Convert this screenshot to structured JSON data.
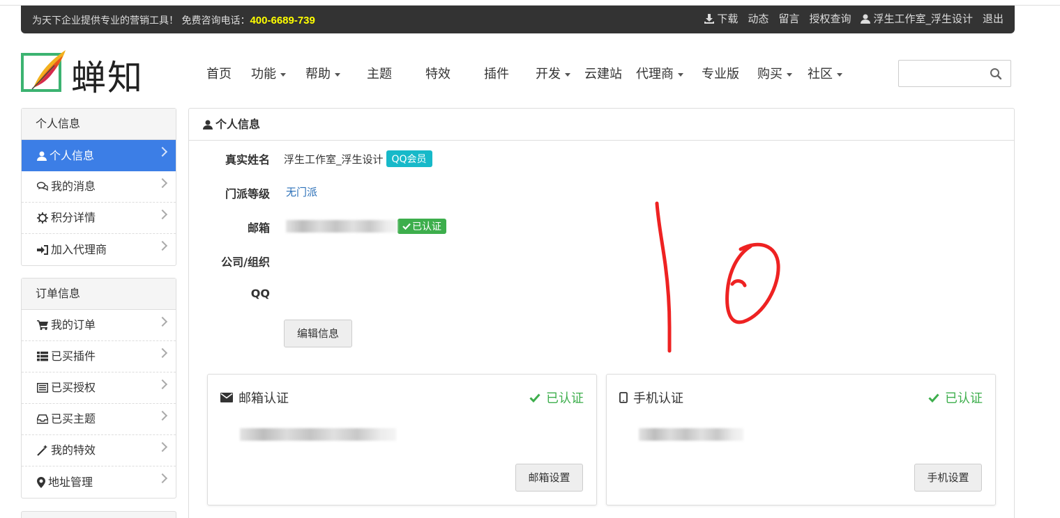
{
  "topbar": {
    "slogan": "为天下企业提供专业的营销工具！ 免费咨询电话：",
    "phone": "400-6689-739",
    "download": "下载",
    "news": "动态",
    "message": "留言",
    "license_query": "授权查询",
    "username": "浮生工作室_浮生设计",
    "logout": "退出"
  },
  "logo": {
    "text": "蝉知"
  },
  "nav": {
    "home": "首页",
    "features": "功能",
    "help": "帮助",
    "themes": "主题",
    "effects": "特效",
    "plugins": "插件",
    "develop": "开发",
    "cloud": "云建站",
    "agent": "代理商",
    "pro": "专业版",
    "buy": "购买",
    "community": "社区"
  },
  "search": {
    "placeholder": ""
  },
  "sidebar": {
    "personal_header": "个人信息",
    "personal_items": [
      "个人信息",
      "我的消息",
      "积分详情",
      "加入代理商"
    ],
    "order_header": "订单信息",
    "order_items": [
      "我的订单",
      "已买插件",
      "已买授权",
      "已买主题",
      "我的特效",
      "地址管理"
    ]
  },
  "main": {
    "title": "个人信息",
    "real_name_label": "真实姓名",
    "real_name_value": "浮生工作室_浮生设计",
    "qq_member_badge": "QQ会员",
    "sect_label": "门派等级",
    "sect_value": "无门派",
    "email_label": "邮箱",
    "verified_badge": "已认证",
    "company_label": "公司/组织",
    "qq_label": "QQ",
    "edit_button": "编辑信息"
  },
  "email_card": {
    "title": "邮箱认证",
    "status": "已认证",
    "button": "邮箱设置"
  },
  "phone_card": {
    "title": "手机认证",
    "status": "已认证",
    "button": "手机设置"
  },
  "colors": {
    "topbar_bg": "#333333",
    "phone_yellow": "#ffff00",
    "active_blue": "#3c7ee6",
    "verified_green": "#3dae4c",
    "qq_badge": "#17b9c9",
    "annotation_red": "#ee2222"
  }
}
